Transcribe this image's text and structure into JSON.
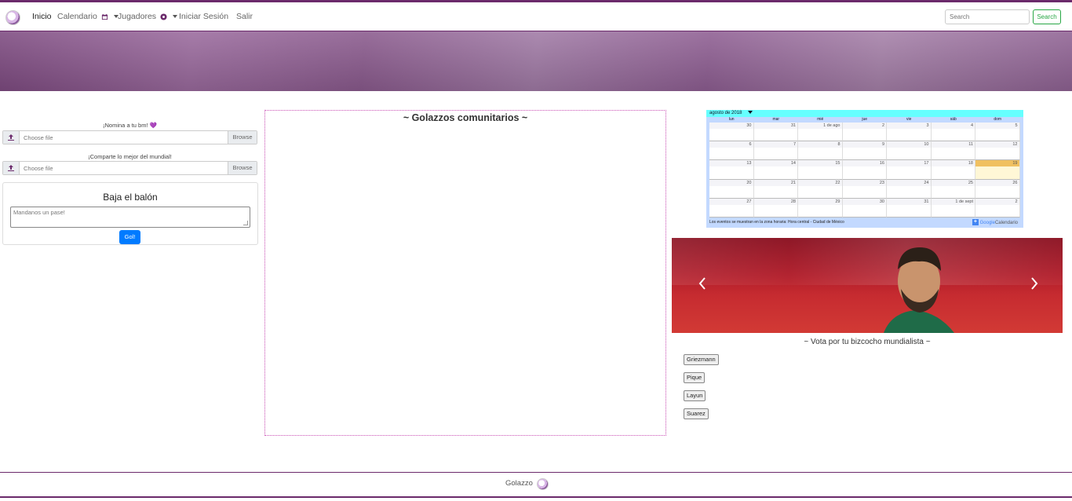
{
  "nav": {
    "home": "Inicio",
    "calendar": "Calendario",
    "players": "Jugadores",
    "login": "Iniciar Sesión",
    "logout": "Salir",
    "search_placeholder": "Search",
    "search_button": "Search"
  },
  "left": {
    "nominate_label": "¡Nomina a tu bm! 💜",
    "share_label": "¡Comparte lo mejor del mundial!",
    "file_placeholder": "Choose file",
    "browse_label": "Browse",
    "post_title": "Baja el balón",
    "post_placeholder": "Mandanos un pase!",
    "post_button": "Gol!"
  },
  "feed": {
    "title": "~ Golazzos comunitarios ~"
  },
  "calendar": {
    "month_label": "agosto de 2018",
    "day_names": [
      "lun",
      "mar",
      "mié",
      "jue",
      "vie",
      "sáb",
      "dom"
    ],
    "weeks": [
      [
        "30",
        "31",
        "1 de ago",
        "2",
        "3",
        "4",
        "5"
      ],
      [
        "6",
        "7",
        "8",
        "9",
        "10",
        "11",
        "12"
      ],
      [
        "13",
        "14",
        "15",
        "16",
        "17",
        "18",
        "19"
      ],
      [
        "20",
        "21",
        "22",
        "23",
        "24",
        "25",
        "26"
      ],
      [
        "27",
        "28",
        "29",
        "30",
        "31",
        "1 de sept",
        "2"
      ]
    ],
    "today": "19",
    "footer_note": "Los eventos se muestran en la zona horaria: Hora central - Ciudad de México",
    "brand": "Google",
    "brand_suffix": "Calendario"
  },
  "vote": {
    "title": "~ Vota por tu bizcocho mundialista ~",
    "options": [
      "Griezmann",
      "Pique",
      "Layun",
      "Suarez"
    ]
  },
  "footer": {
    "text": "Golazzo"
  },
  "colors": {
    "brand_purple": "#6b2a6b",
    "accent_pink": "#c94fb4",
    "primary_blue": "#007bff",
    "success_green": "#28a745"
  }
}
